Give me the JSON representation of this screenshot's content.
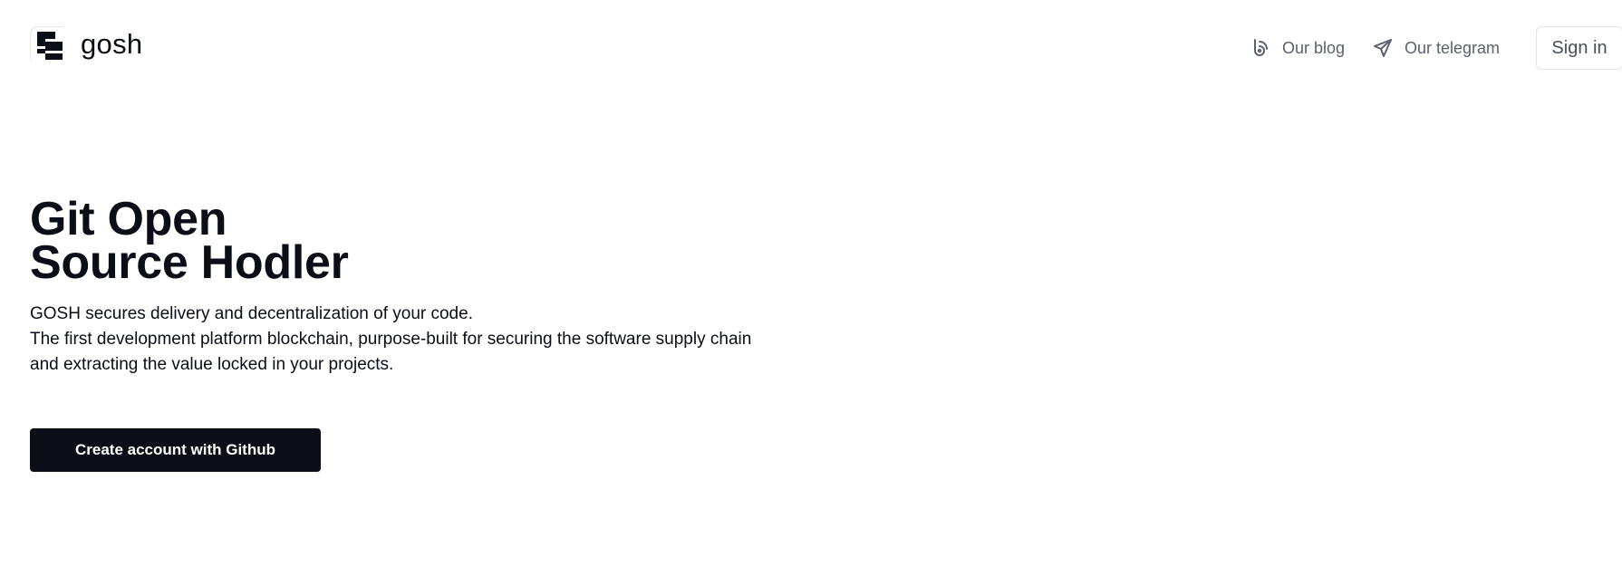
{
  "header": {
    "logo": {
      "icon": "gosh-logo-icon",
      "text": "gosh"
    },
    "nav": {
      "blog": {
        "label": "Our blog",
        "icon": "blog-icon"
      },
      "telegram": {
        "label": "Our telegram",
        "icon": "telegram-send-icon"
      },
      "signin": {
        "label": "Sign in"
      }
    }
  },
  "hero": {
    "title_line1": "Git Open",
    "title_line2": "Source Hodler",
    "desc_line1": "GOSH secures delivery and decentralization of your code.",
    "desc_line2": "The first development platform blockchain, purpose-built for securing the software supply chain",
    "desc_line3": "and extracting the value locked in your projects.",
    "cta_label": "Create account with Github"
  },
  "colors": {
    "primary": "#0b0d17",
    "nav_text": "#5c6170",
    "border": "#e1e3e8",
    "background": "#ffffff"
  }
}
